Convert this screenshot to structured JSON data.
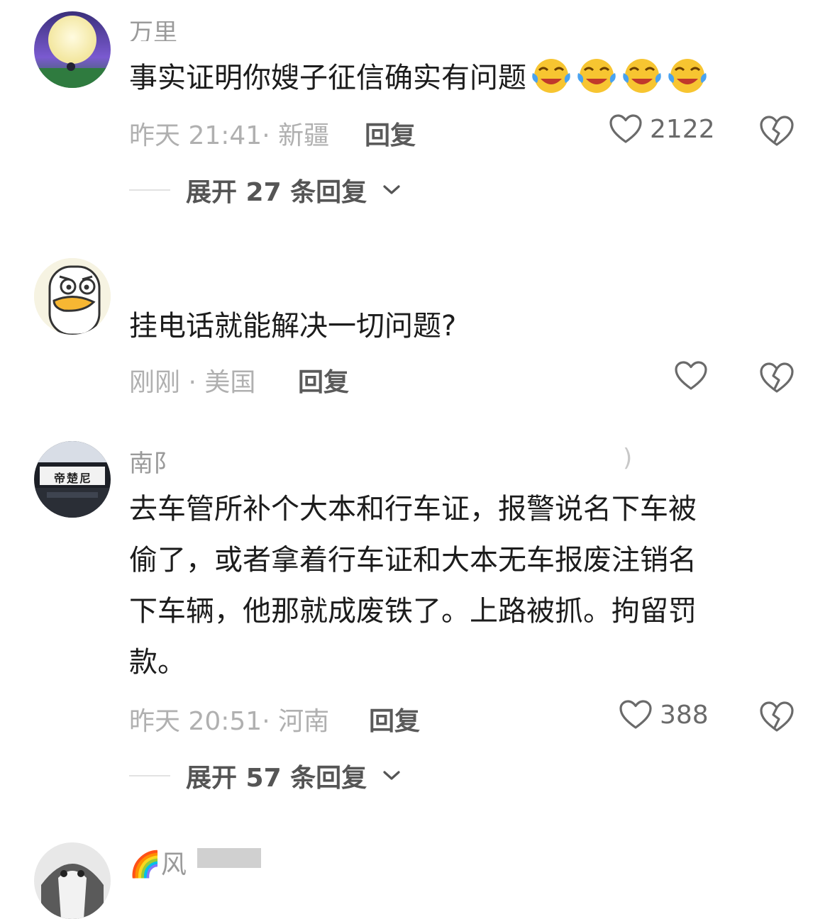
{
  "comments": [
    {
      "username_partial": "万里",
      "text": "事实证明你嫂子征信确实有问题",
      "emoji_icons": [
        "crying-laughing-icon",
        "crying-laughing-icon",
        "crying-laughing-icon",
        "crying-laughing-icon"
      ],
      "time_location": "昨天 21:41· 新疆",
      "reply_label": "回复",
      "likes": "2122",
      "expand_label": "展开 27 条回复"
    },
    {
      "username_partial": "",
      "text": "挂电话就能解决一切问题?",
      "time_location": "刚刚 · 美国",
      "reply_label": "回复",
      "likes": ""
    },
    {
      "username_partial": "南阝",
      "username_suffix": ")",
      "text": "去车管所补个大本和行车证，报警说名下车被偷了，或者拿着行车证和大本无车报废注销名下车辆，他那就成废铁了。上路被抓。拘留罚款。",
      "text_lines": [
        "去车管所补个大本和行车证，报警说名下车被",
        "偷了，或者拿着行车证和大本无车报废注销名",
        "下车辆，他那就成废铁了。上路被抓。拘留罚",
        "款。"
      ],
      "avatar_text": "帝楚尼",
      "time_location": "昨天 20:51· 河南",
      "reply_label": "回复",
      "likes": "388",
      "expand_label": "展开 57 条回复"
    },
    {
      "username_partial": "🌈风"
    }
  ],
  "colors": {
    "text": "#1c1c1c",
    "meta": "#b0b0b0",
    "reply": "#5a5a5a",
    "icon": "#6a6a6a"
  }
}
